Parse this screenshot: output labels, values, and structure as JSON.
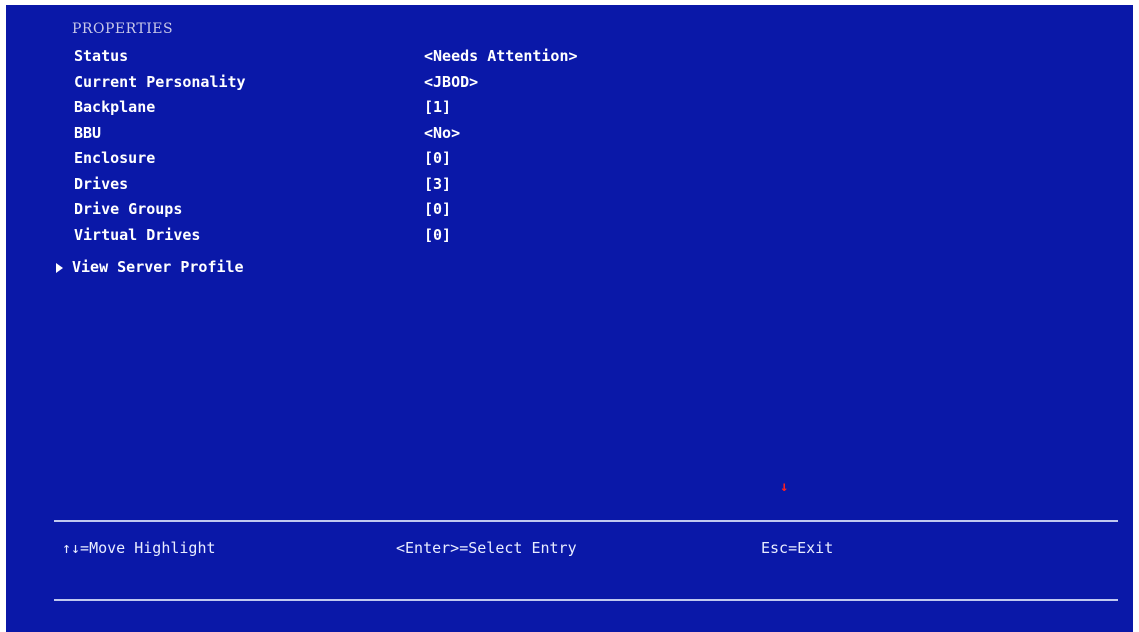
{
  "section_title": "PROPERTIES",
  "properties": [
    {
      "label": "Status",
      "value": "<Needs Attention>"
    },
    {
      "label": "Current Personality",
      "value": "<JBOD>"
    },
    {
      "label": "Backplane",
      "value": "[1]"
    },
    {
      "label": "BBU",
      "value": "<No>"
    },
    {
      "label": "Enclosure",
      "value": "[0]"
    },
    {
      "label": "Drives",
      "value": "[3]"
    },
    {
      "label": "Drive Groups",
      "value": "[0]"
    },
    {
      "label": "Virtual Drives",
      "value": "[0]"
    }
  ],
  "submenu": {
    "label": "View Server Profile"
  },
  "marker": "↓",
  "footer": {
    "move": "↑↓=Move Highlight",
    "enter": "<Enter>=Select Entry",
    "esc": "Esc=Exit"
  },
  "colors": {
    "background": "#0a18a8",
    "text": "#ffffff",
    "marker": "#ff2020"
  }
}
